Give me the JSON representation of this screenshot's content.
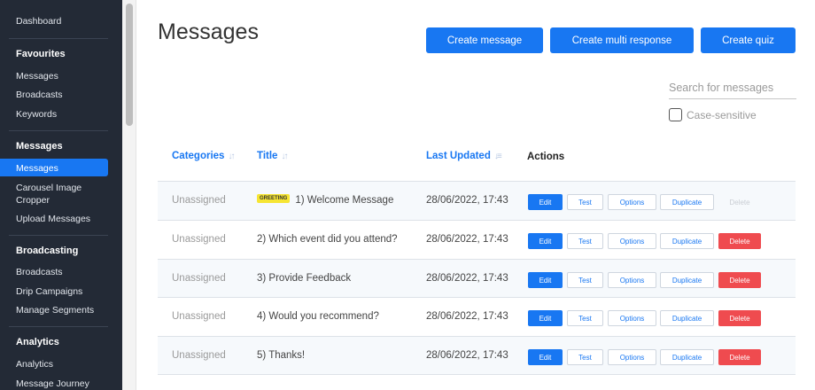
{
  "sidebar": {
    "dashboard": "Dashboard",
    "favourites": {
      "heading": "Favourites",
      "items": [
        "Messages",
        "Broadcasts",
        "Keywords"
      ]
    },
    "messages": {
      "heading": "Messages",
      "items": [
        "Messages",
        "Carousel Image Cropper",
        "Upload Messages"
      ]
    },
    "broadcasting": {
      "heading": "Broadcasting",
      "items": [
        "Broadcasts",
        "Drip Campaigns",
        "Manage Segments"
      ]
    },
    "analytics": {
      "heading": "Analytics",
      "items": [
        "Analytics",
        "Message Journey"
      ]
    },
    "active_color": "#1877f2"
  },
  "page": {
    "title": "Messages",
    "buttons": {
      "create_message": "Create message",
      "create_multi_response": "Create multi response",
      "create_quiz": "Create quiz"
    },
    "search": {
      "placeholder": "Search for messages",
      "value": ""
    },
    "case_sensitive_label": "Case-sensitive"
  },
  "table": {
    "headers": {
      "categories": "Categories",
      "title": "Title",
      "last_updated": "Last Updated",
      "actions": "Actions"
    },
    "actions": {
      "edit": "Edit",
      "test": "Test",
      "options": "Options",
      "duplicate": "Duplicate",
      "delete": "Delete"
    },
    "rows": [
      {
        "category": "Unassigned",
        "badge": "GREETING",
        "title": "1) Welcome Message",
        "updated": "28/06/2022, 17:43"
      },
      {
        "category": "Unassigned",
        "title": "2) Which event did you attend?",
        "updated": "28/06/2022, 17:43"
      },
      {
        "category": "Unassigned",
        "title": "3) Provide Feedback",
        "updated": "28/06/2022, 17:43"
      },
      {
        "category": "Unassigned",
        "title": "4) Would you recommend?",
        "updated": "28/06/2022, 17:43"
      },
      {
        "category": "Unassigned",
        "title": "5) Thanks!",
        "updated": "28/06/2022, 17:43"
      }
    ]
  }
}
